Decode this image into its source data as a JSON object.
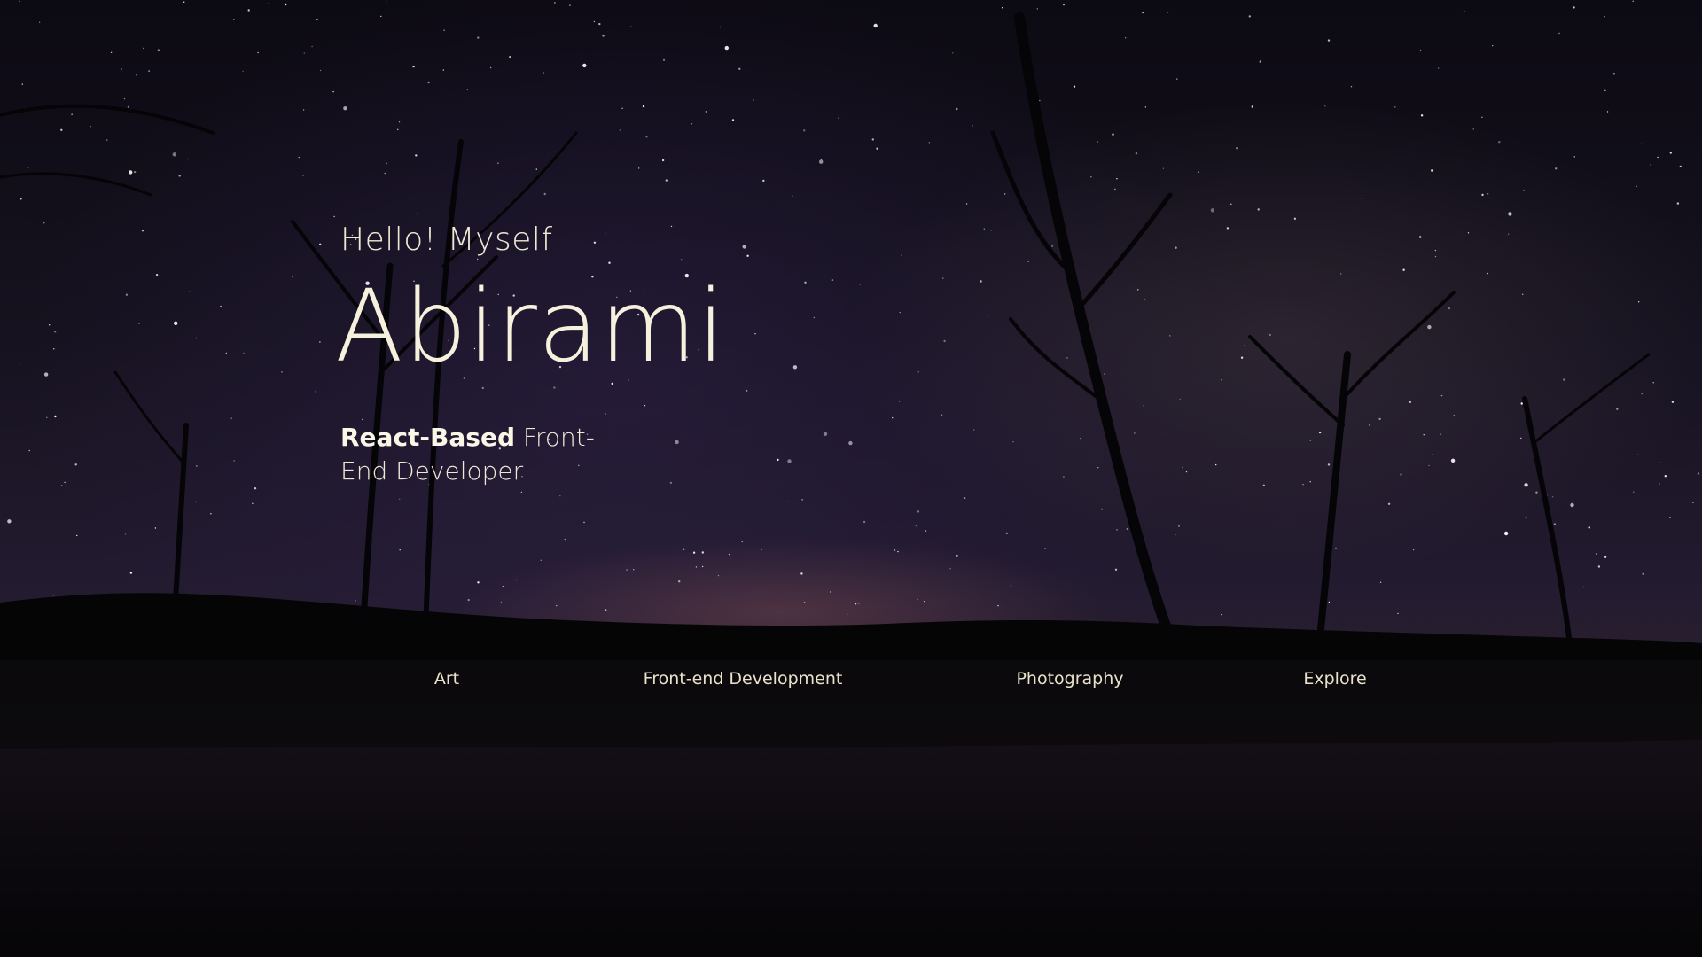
{
  "hero": {
    "greeting": "Hello! Myself",
    "name": "Abirami",
    "tagline_strong": "React-Based",
    "tagline_rest": " Front-End Developer"
  },
  "nav": {
    "items": [
      {
        "label": "Art"
      },
      {
        "label": "Front-end Development"
      },
      {
        "label": "Photography"
      },
      {
        "label": "Explore"
      }
    ]
  },
  "theme": {
    "text_color": "#f3eed9",
    "sky_color": "#16121f",
    "ground_color": "#060507"
  }
}
